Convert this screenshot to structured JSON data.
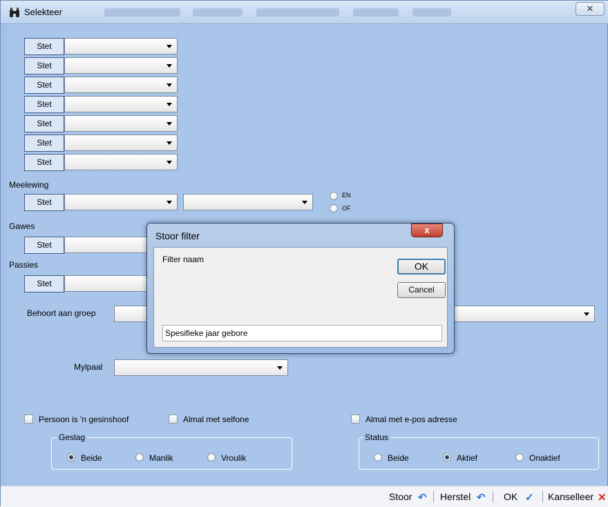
{
  "window": {
    "title": "Selekteer",
    "close_glyph": "✕",
    "icon": "binoculars-icon"
  },
  "stet_rows": [
    {
      "button": "Stet",
      "value": ""
    },
    {
      "button": "Stet",
      "value": ""
    },
    {
      "button": "Stet",
      "value": ""
    },
    {
      "button": "Stet",
      "value": ""
    },
    {
      "button": "Stet",
      "value": ""
    },
    {
      "button": "Stet",
      "value": ""
    },
    {
      "button": "Stet",
      "value": ""
    }
  ],
  "meelewing": {
    "label": "Meelewing",
    "button": "Stet",
    "combo1": "",
    "combo2": "",
    "radio_en": "EN",
    "radio_of": "OF"
  },
  "gawes": {
    "label": "Gawes",
    "button": "Stet"
  },
  "passies": {
    "label": "Passies",
    "button": "Stet"
  },
  "behoort": {
    "label": "Behoort aan groep",
    "value": ""
  },
  "mylpaal": {
    "label": "Mylpaal",
    "value": ""
  },
  "checkboxes": {
    "gesinshoof": "Persoon is 'n gesinshoof",
    "selfone": "Almal met selfone",
    "epos": "Almal met e-pos adresse"
  },
  "geslag": {
    "title": "Geslag",
    "options": [
      "Beide",
      "Manlik",
      "Vroulik"
    ],
    "selected": "Beide"
  },
  "status": {
    "title": "Status",
    "options": [
      "Beide",
      "Aktief",
      "Onaktief"
    ],
    "selected": "Aktief"
  },
  "dialog": {
    "title": "Stoor filter",
    "close_glyph": "x",
    "label": "Filter naam",
    "ok": "OK",
    "cancel": "Cancel",
    "input_value": "Spesifieke jaar gebore"
  },
  "bottombar": {
    "stoor": "Stoor",
    "herstel": "Herstel",
    "ok": "OK",
    "kanselleer": "Kanselleer"
  }
}
